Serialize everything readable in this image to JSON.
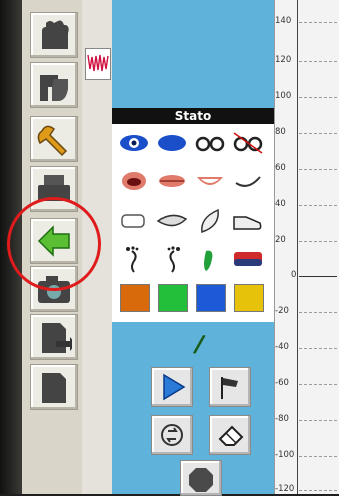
{
  "state_panel": {
    "title": "Stato",
    "rows": [
      [
        "eye-open-icon",
        "eye-closed-icon",
        "glasses-icon",
        "glasses-crossed-icon"
      ],
      [
        "mouth-open-icon",
        "mouth-closed-icon",
        "mouth-smile-icon",
        "mouth-line-icon"
      ],
      [
        "bandage-icon",
        "sole-icon",
        "leaf-icon",
        "shoe-icon"
      ],
      [
        "footprint-left-icon",
        "footprint-right-icon",
        "green-footprint-icon",
        "eraser-icon"
      ]
    ],
    "colors": [
      "#d96a0c",
      "#22c03a",
      "#1d5ad8",
      "#e6c20a"
    ],
    "slash_text": "/"
  },
  "ruler": {
    "labels": [
      "140",
      "120",
      "100",
      "80",
      "60",
      "40",
      "20",
      "0",
      "-20",
      "-40",
      "-60",
      "-80",
      "-100",
      "-120"
    ]
  },
  "toolbar": {
    "icons": [
      "hand-icon",
      "hand-flag-icon",
      "wrench-icon",
      "printer-icon",
      "back-arrow-icon",
      "camera-icon",
      "page-arrow-icon",
      "page-icon"
    ]
  },
  "controls": [
    "play-button",
    "flag-button",
    "refresh-button",
    "eraser-button",
    "stop-button"
  ]
}
